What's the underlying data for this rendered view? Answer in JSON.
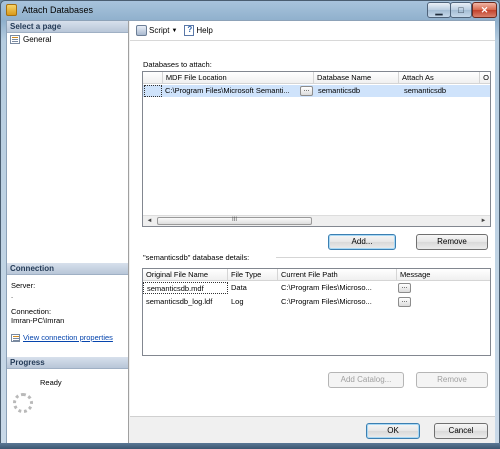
{
  "window": {
    "title": "Attach Databases",
    "buttons": {
      "minimize": "▁",
      "maximize": "□",
      "close": "✕"
    }
  },
  "left_panel": {
    "select_page_header": "Select a page",
    "pages": [
      {
        "label": "General",
        "icon": "page-icon"
      }
    ],
    "connection_header": "Connection",
    "server_label": "Server:",
    "server_value": ".",
    "connection_label": "Connection:",
    "connection_value": "Imran-PC\\Imran",
    "view_link": "View connection properties",
    "progress_header": "Progress",
    "progress_status": "Ready"
  },
  "toolbar": {
    "script_label": "Script",
    "script_dropdown": "▼",
    "help_label": "Help"
  },
  "databases_to_attach": {
    "label": "Databases to attach:",
    "columns": [
      "",
      "MDF File Location",
      "Database Name",
      "Attach As",
      "O"
    ],
    "rows": [
      {
        "mdf": "C:\\Program Files\\Microsoft Semanti...",
        "ellipsis": "...",
        "db_name": "semanticsdb",
        "attach_as": "semanticsdb"
      }
    ],
    "scroll_left": "◄",
    "scroll_right": "►",
    "scroll_thumb": "III"
  },
  "buttons_top": {
    "add": "Add...",
    "remove": "Remove"
  },
  "details": {
    "label": "\"semanticsdb\" database details:",
    "columns": [
      "Original File Name",
      "File Type",
      "Current File Path",
      "Message"
    ],
    "rows": [
      {
        "name": "semanticsdb.mdf",
        "type": "Data",
        "path": "C:\\Program Files\\Microso...",
        "ellipsis": "..."
      },
      {
        "name": "semanticsdb_log.ldf",
        "type": "Log",
        "path": "C:\\Program Files\\Microso...",
        "ellipsis": "..."
      }
    ]
  },
  "buttons_bottom": {
    "add_catalog": "Add Catalog...",
    "remove": "Remove"
  },
  "footer": {
    "ok": "OK",
    "cancel": "Cancel"
  }
}
